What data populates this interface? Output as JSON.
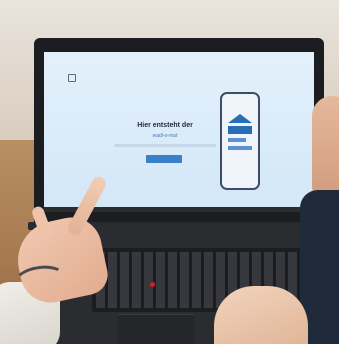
{
  "screen": {
    "headline": "Hier entsteht der",
    "subline": "wadl-o-mat"
  },
  "colors": {
    "screen_bg": "#dbeaf8",
    "accent": "#2b6db5",
    "trackpoint": "#d01f25"
  }
}
